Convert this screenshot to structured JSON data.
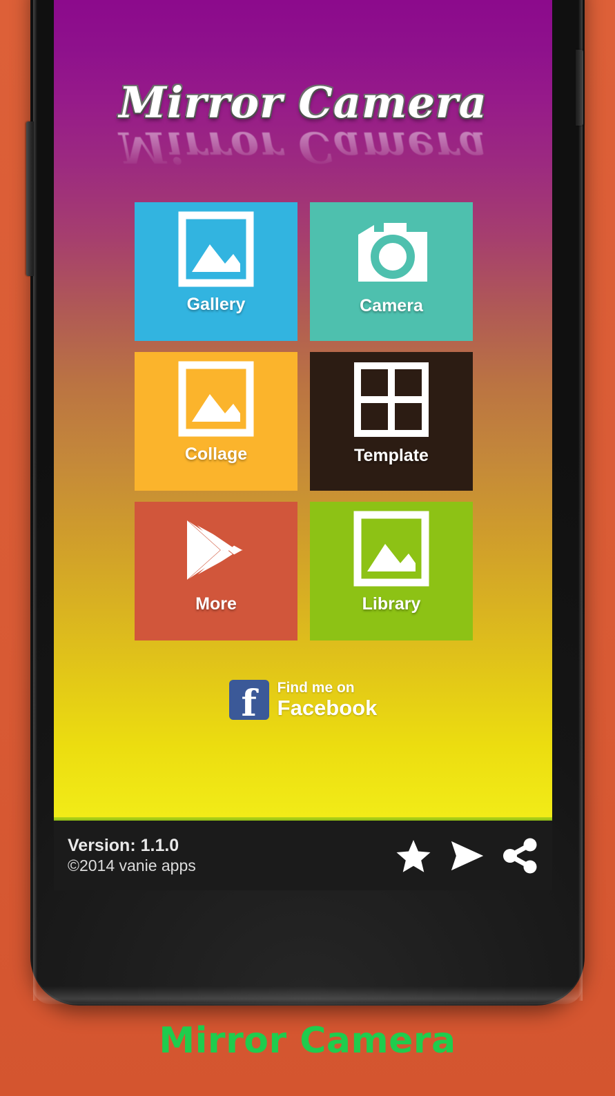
{
  "app": {
    "title": "Mirror Camera",
    "caption": "Mirror Camera"
  },
  "colors": {
    "page_background": "#d95b35",
    "gradient_top": "#8c0a8c",
    "gradient_bottom": "#f2ec18",
    "caption_green": "#1fcc4d",
    "footer_bar": "#1b1b1b",
    "facebook_blue": "#3b5998"
  },
  "grid": {
    "tiles": [
      {
        "label": "Gallery",
        "icon": "photo-icon",
        "color": "#32b4e0"
      },
      {
        "label": "Camera",
        "icon": "camera-icon",
        "color": "#4ec0ae"
      },
      {
        "label": "Collage",
        "icon": "photo-icon",
        "color": "#fbb42c"
      },
      {
        "label": "Template",
        "icon": "grid-2x2-icon",
        "color": "#2c1c13"
      },
      {
        "label": "More",
        "icon": "play-store-icon",
        "color": "#d1563b"
      },
      {
        "label": "Library",
        "icon": "photo-icon",
        "color": "#8dc215"
      }
    ]
  },
  "facebook": {
    "small_text": "Find me on",
    "big_text": "Facebook",
    "icon": "facebook-f-icon",
    "glyph": "f"
  },
  "footer": {
    "version": "Version: 1.1.0",
    "copyright": "©2014 vanie apps",
    "actions": [
      {
        "name": "rate-star-icon",
        "label": "star"
      },
      {
        "name": "send-icon",
        "label": "send"
      },
      {
        "name": "share-icon",
        "label": "share"
      }
    ]
  },
  "device": {
    "volume_button": "volume-button",
    "power_button": "power-button"
  }
}
